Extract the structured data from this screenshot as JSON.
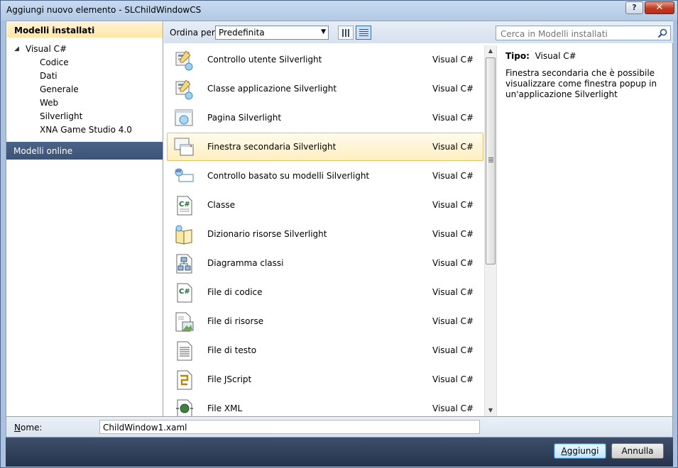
{
  "window": {
    "title": "Aggiungi nuovo elemento - SLChildWindowCS",
    "help_label": "?",
    "close_label": "✕"
  },
  "left": {
    "header": "Modelli installati",
    "tree_root": "Visual C#",
    "tree_children": [
      "Codice",
      "Dati",
      "Generale",
      "Web",
      "Silverlight",
      "XNA Game Studio 4.0"
    ],
    "online": "Modelli online"
  },
  "toolbar": {
    "sort_label": "Ordina per:",
    "sort_value": "Predefinita",
    "search_placeholder": "Cerca in Modelli installati"
  },
  "items": [
    {
      "name": "Controllo utente Silverlight",
      "lang": "Visual C#",
      "icon": "user-control-icon"
    },
    {
      "name": "Classe applicazione Silverlight",
      "lang": "Visual C#",
      "icon": "application-class-icon"
    },
    {
      "name": "Pagina Silverlight",
      "lang": "Visual C#",
      "icon": "page-icon"
    },
    {
      "name": "Finestra secondaria Silverlight",
      "lang": "Visual C#",
      "icon": "child-window-icon",
      "selected": true
    },
    {
      "name": "Controllo basato su modelli Silverlight",
      "lang": "Visual C#",
      "icon": "templated-control-icon"
    },
    {
      "name": "Classe",
      "lang": "Visual C#",
      "icon": "class-file-icon"
    },
    {
      "name": "Dizionario risorse Silverlight",
      "lang": "Visual C#",
      "icon": "resource-dictionary-icon"
    },
    {
      "name": "Diagramma classi",
      "lang": "Visual C#",
      "icon": "class-diagram-icon"
    },
    {
      "name": "File di codice",
      "lang": "Visual C#",
      "icon": "code-file-icon"
    },
    {
      "name": "File di risorse",
      "lang": "Visual C#",
      "icon": "resource-file-icon"
    },
    {
      "name": "File di testo",
      "lang": "Visual C#",
      "icon": "text-file-icon"
    },
    {
      "name": "File JScript",
      "lang": "Visual C#",
      "icon": "jscript-file-icon"
    },
    {
      "name": "File XML",
      "lang": "Visual C#",
      "icon": "xml-file-icon"
    }
  ],
  "details": {
    "type_label": "Tipo:",
    "type_value": "Visual C#",
    "description": "Finestra secondaria che è possibile visualizzare come finestra popup in un'applicazione Silverlight"
  },
  "name_field": {
    "label_first": "N",
    "label_rest": "ome:",
    "value": "ChildWindow1.xaml"
  },
  "buttons": {
    "add_first": "A",
    "add_rest": "ggiungi",
    "cancel": "Annulla"
  },
  "colors": {
    "selection": "#ffefc0",
    "online_bg": "#3d5478",
    "footer_bg": "#25334c"
  }
}
